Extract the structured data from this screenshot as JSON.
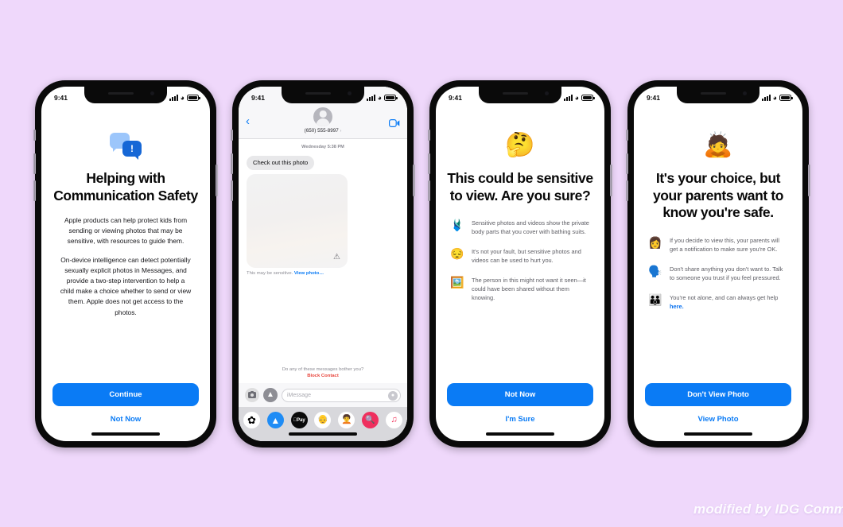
{
  "background_color": "#efd8fb",
  "accent_color": "#0a7bf5",
  "watermark": "modified by IDG Comm",
  "phones": [
    {
      "name": "communication-safety-intro",
      "status": {
        "time": "9:41",
        "signal": "cellular-bars-icon",
        "wifi": "wifi-icon",
        "battery": "battery-icon"
      },
      "icon": "chat-bubbles-alert-icon",
      "headline": "Helping with Communication Safety",
      "paragraphs": [
        "Apple products can help protect kids from sending or viewing photos that may be sensitive, with resources to guide them.",
        "On-device intelligence can detect potentially sexually explicit photos in Messages, and provide a two-step intervention to help a child make a choice whether to send or view them. Apple does not get access to the photos."
      ],
      "primary_button": "Continue",
      "secondary_button": "Not Now"
    },
    {
      "name": "messages-conversation",
      "status": {
        "time": "9:41",
        "signal": "cellular-bars-icon",
        "wifi": "wifi-icon",
        "battery": "battery-icon"
      },
      "nav": {
        "back": "chevron-left-icon",
        "avatar": "contact-avatar-icon",
        "contact": "(650) 555-8997",
        "contact_chevron": "chevron-right-icon",
        "facetime": "facetime-video-icon"
      },
      "timestamp": "Wednesday 5:38 PM",
      "incoming_message": "Check out this photo",
      "photo_warning_icon": "warning-triangle-icon",
      "sensitive_note": "This may be sensitive.",
      "sensitive_link": "View photo…",
      "block_prompt": "Do any of these messages bother you?",
      "block_link": "Block Contact",
      "composer": {
        "camera": "camera-icon",
        "apps": "app-store-icon",
        "placeholder": "iMessage",
        "mic": "audio-wave-icon"
      },
      "app_tray": [
        {
          "name": "photos-app-icon",
          "glyph": "✿"
        },
        {
          "name": "app-store-icon",
          "glyph": "A"
        },
        {
          "name": "apple-pay-icon",
          "glyph": "Pay"
        },
        {
          "name": "memoji-icon",
          "glyph": "👴"
        },
        {
          "name": "memoji-alt-icon",
          "glyph": "🧑‍🦱"
        },
        {
          "name": "images-search-icon",
          "glyph": "🔍"
        },
        {
          "name": "music-app-icon",
          "glyph": "♫"
        }
      ]
    },
    {
      "name": "sensitive-warning",
      "status": {
        "time": "9:41",
        "signal": "cellular-bars-icon",
        "wifi": "wifi-icon",
        "battery": "battery-icon"
      },
      "emoji": "🤔",
      "emoji_name": "thinking-face-emoji",
      "headline": "This could be sensitive to view. Are you sure?",
      "bullets": [
        {
          "emoji": "🩱",
          "emoji_name": "swimsuit-emoji",
          "text": "Sensitive photos and videos show the private body parts that you cover with bathing suits."
        },
        {
          "emoji": "😔",
          "emoji_name": "pensive-face-emoji",
          "text": "It's not your fault, but sensitive photos and videos can be used to hurt you."
        },
        {
          "emoji": "🖼️",
          "emoji_name": "framed-picture-emoji",
          "text": "The person in this might not want it seen—it could have been shared without them knowing."
        }
      ],
      "primary_button": "Not Now",
      "secondary_button": "I'm Sure"
    },
    {
      "name": "parent-notification",
      "status": {
        "time": "9:41",
        "signal": "cellular-bars-icon",
        "wifi": "wifi-icon",
        "battery": "battery-icon"
      },
      "emoji": "🙇",
      "emoji_name": "person-bowing-emoji",
      "headline": "It's your choice, but your parents want to know you're safe.",
      "bullets": [
        {
          "emoji": "👩",
          "emoji_name": "woman-notification-emoji",
          "text": "If you decide to view this, your parents will get a notification to make sure you're OK.",
          "link": null
        },
        {
          "emoji": "🗣️",
          "emoji_name": "speaking-head-emoji",
          "text": "Don't share anything you don't want to. Talk to someone you trust if you feel pressured.",
          "link": null
        },
        {
          "emoji": "👪",
          "emoji_name": "family-emoji",
          "text": "You're not alone, and can always get help ",
          "link": "here."
        }
      ],
      "primary_button": "Don't View Photo",
      "secondary_button": "View Photo"
    }
  ]
}
